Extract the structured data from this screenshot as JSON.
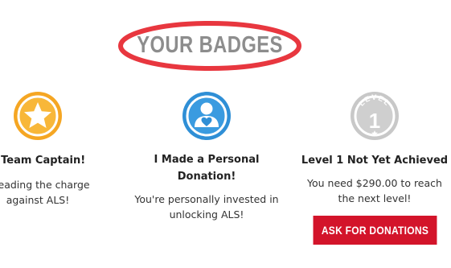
{
  "header": {
    "title": "YOUR BADGES",
    "ellipse_color": "#e8373f"
  },
  "badges": [
    {
      "id": "team-captain",
      "icon": "star-icon",
      "icon_color": "#f5a623",
      "title_line1": "a Team Captain!",
      "desc_line1": "e leading the charge",
      "desc_line2": "against ALS!"
    },
    {
      "id": "personal-donation",
      "icon": "person-heart-icon",
      "icon_color": "#2f8fd6",
      "title_line1": "I Made a Personal",
      "title_line2": "Donation!",
      "desc_line1": "You're personally invested in",
      "desc_line2": "unlocking ALS!"
    },
    {
      "id": "level-1",
      "icon": "level-1-icon",
      "icon_color": "#c8c8c8",
      "icon_label": "LEVEL",
      "icon_number": "1",
      "title_line1": "Level 1 Not Yet Achieved",
      "desc_line1": "You need $290.00 to reach",
      "desc_line2": "the next level!",
      "button_label": "ASK FOR DONATIONS",
      "button_color": "#d3142a"
    }
  ]
}
